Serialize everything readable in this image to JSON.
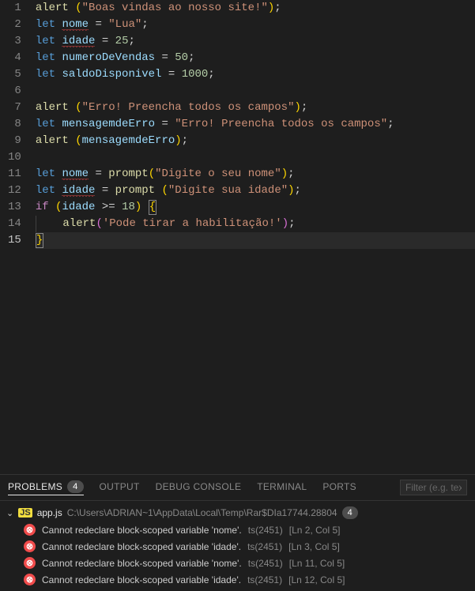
{
  "code": {
    "lines": [
      {
        "n": 1,
        "tokens": [
          {
            "t": "alert",
            "c": "tok-fn"
          },
          {
            "t": " ",
            "c": ""
          },
          {
            "t": "(",
            "c": "tok-brace"
          },
          {
            "t": "\"Boas vindas ao nosso site!\"",
            "c": "tok-str"
          },
          {
            "t": ")",
            "c": "tok-brace"
          },
          {
            "t": ";",
            "c": "tok-punc"
          }
        ]
      },
      {
        "n": 2,
        "tokens": [
          {
            "t": "let",
            "c": "tok-kw"
          },
          {
            "t": " ",
            "c": ""
          },
          {
            "t": "nome",
            "c": "tok-var",
            "sq": true
          },
          {
            "t": " = ",
            "c": "tok-punc"
          },
          {
            "t": "\"Lua\"",
            "c": "tok-str"
          },
          {
            "t": ";",
            "c": "tok-punc"
          }
        ]
      },
      {
        "n": 3,
        "tokens": [
          {
            "t": "let",
            "c": "tok-kw"
          },
          {
            "t": " ",
            "c": ""
          },
          {
            "t": "idade",
            "c": "tok-var",
            "sq": true
          },
          {
            "t": " = ",
            "c": "tok-punc"
          },
          {
            "t": "25",
            "c": "tok-num"
          },
          {
            "t": ";",
            "c": "tok-punc"
          }
        ]
      },
      {
        "n": 4,
        "tokens": [
          {
            "t": "let",
            "c": "tok-kw"
          },
          {
            "t": " ",
            "c": ""
          },
          {
            "t": "numeroDeVendas",
            "c": "tok-var"
          },
          {
            "t": " = ",
            "c": "tok-punc"
          },
          {
            "t": "50",
            "c": "tok-num"
          },
          {
            "t": ";",
            "c": "tok-punc"
          }
        ]
      },
      {
        "n": 5,
        "tokens": [
          {
            "t": "let",
            "c": "tok-kw"
          },
          {
            "t": " ",
            "c": ""
          },
          {
            "t": "saldoDisponivel",
            "c": "tok-var"
          },
          {
            "t": " = ",
            "c": "tok-punc"
          },
          {
            "t": "1000",
            "c": "tok-num"
          },
          {
            "t": ";",
            "c": "tok-punc"
          }
        ]
      },
      {
        "n": 6,
        "tokens": []
      },
      {
        "n": 7,
        "tokens": [
          {
            "t": "alert",
            "c": "tok-fn"
          },
          {
            "t": " ",
            "c": ""
          },
          {
            "t": "(",
            "c": "tok-brace"
          },
          {
            "t": "\"Erro! Preencha todos os campos\"",
            "c": "tok-str"
          },
          {
            "t": ")",
            "c": "tok-brace"
          },
          {
            "t": ";",
            "c": "tok-punc"
          }
        ]
      },
      {
        "n": 8,
        "tokens": [
          {
            "t": "let",
            "c": "tok-kw"
          },
          {
            "t": " ",
            "c": ""
          },
          {
            "t": "mensagemdeErro",
            "c": "tok-var"
          },
          {
            "t": " = ",
            "c": "tok-punc"
          },
          {
            "t": "\"Erro! Preencha todos os campos\"",
            "c": "tok-str"
          },
          {
            "t": ";",
            "c": "tok-punc"
          }
        ]
      },
      {
        "n": 9,
        "tokens": [
          {
            "t": "alert",
            "c": "tok-fn"
          },
          {
            "t": " ",
            "c": ""
          },
          {
            "t": "(",
            "c": "tok-brace"
          },
          {
            "t": "mensagemdeErro",
            "c": "tok-var"
          },
          {
            "t": ")",
            "c": "tok-brace"
          },
          {
            "t": ";",
            "c": "tok-punc"
          }
        ]
      },
      {
        "n": 10,
        "tokens": []
      },
      {
        "n": 11,
        "tokens": [
          {
            "t": "let",
            "c": "tok-kw"
          },
          {
            "t": " ",
            "c": ""
          },
          {
            "t": "nome",
            "c": "tok-var",
            "sq": true
          },
          {
            "t": " = ",
            "c": "tok-punc"
          },
          {
            "t": "prompt",
            "c": "tok-fn"
          },
          {
            "t": "(",
            "c": "tok-brace"
          },
          {
            "t": "\"Digite o seu nome\"",
            "c": "tok-str"
          },
          {
            "t": ")",
            "c": "tok-brace"
          },
          {
            "t": ";",
            "c": "tok-punc"
          }
        ]
      },
      {
        "n": 12,
        "tokens": [
          {
            "t": "let",
            "c": "tok-kw"
          },
          {
            "t": " ",
            "c": ""
          },
          {
            "t": "idade",
            "c": "tok-var",
            "sq": true
          },
          {
            "t": " = ",
            "c": "tok-punc"
          },
          {
            "t": "prompt",
            "c": "tok-fn"
          },
          {
            "t": " ",
            "c": ""
          },
          {
            "t": "(",
            "c": "tok-brace"
          },
          {
            "t": "\"Digite sua idade\"",
            "c": "tok-str"
          },
          {
            "t": ")",
            "c": "tok-brace"
          },
          {
            "t": ";",
            "c": "tok-punc"
          }
        ]
      },
      {
        "n": 13,
        "tokens": [
          {
            "t": "if",
            "c": "tok-ctrl"
          },
          {
            "t": " ",
            "c": ""
          },
          {
            "t": "(",
            "c": "tok-brace"
          },
          {
            "t": "idade",
            "c": "tok-var"
          },
          {
            "t": " >= ",
            "c": "tok-punc"
          },
          {
            "t": "18",
            "c": "tok-num"
          },
          {
            "t": ")",
            "c": "tok-brace"
          },
          {
            "t": " ",
            "c": ""
          },
          {
            "t": "{",
            "c": "tok-brace",
            "box": true
          }
        ]
      },
      {
        "n": 14,
        "indent": true,
        "tokens": [
          {
            "t": "alert",
            "c": "tok-fn"
          },
          {
            "t": "(",
            "c": "tok-brace2"
          },
          {
            "t": "'Pode tirar a habilitação!'",
            "c": "tok-str"
          },
          {
            "t": ")",
            "c": "tok-brace2"
          },
          {
            "t": ";",
            "c": "tok-punc"
          }
        ]
      },
      {
        "n": 15,
        "current": true,
        "tokens": [
          {
            "t": "}",
            "c": "tok-brace",
            "box": true
          }
        ]
      }
    ]
  },
  "panel": {
    "tabs": {
      "problems": "PROBLEMS",
      "output": "OUTPUT",
      "debug": "DEBUG CONSOLE",
      "terminal": "TERMINAL",
      "ports": "PORTS"
    },
    "problemsCount": "4",
    "filterPlaceholder": "Filter (e.g. text"
  },
  "problems": {
    "file": {
      "icon": "JS",
      "name": "app.js",
      "path": "C:\\Users\\ADRIAN~1\\AppData\\Local\\Temp\\Rar$DIa17744.28804",
      "count": "4"
    },
    "items": [
      {
        "msg": "Cannot redeclare block-scoped variable 'nome'.",
        "code": "ts(2451)",
        "loc": "[Ln 2, Col 5]"
      },
      {
        "msg": "Cannot redeclare block-scoped variable 'idade'.",
        "code": "ts(2451)",
        "loc": "[Ln 3, Col 5]"
      },
      {
        "msg": "Cannot redeclare block-scoped variable 'nome'.",
        "code": "ts(2451)",
        "loc": "[Ln 11, Col 5]"
      },
      {
        "msg": "Cannot redeclare block-scoped variable 'idade'.",
        "code": "ts(2451)",
        "loc": "[Ln 12, Col 5]"
      }
    ]
  }
}
